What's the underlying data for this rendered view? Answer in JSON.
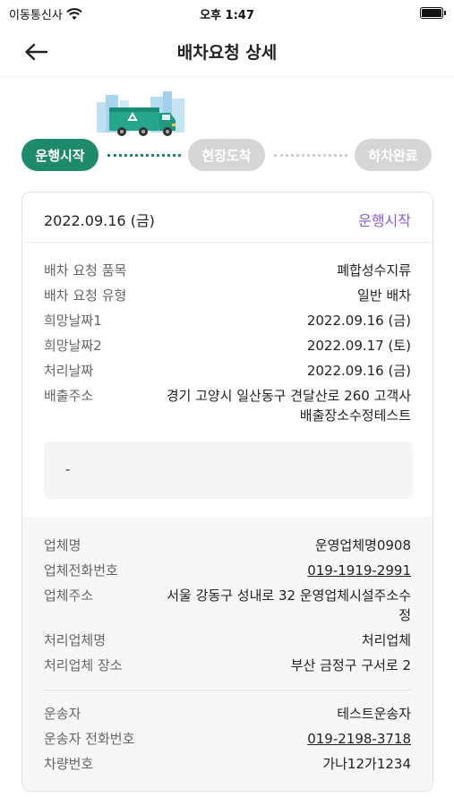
{
  "status_bar": {
    "carrier": "이동통신사",
    "time": "오후 1:47"
  },
  "header": {
    "title": "배차요청 상세"
  },
  "stepper": {
    "steps": [
      {
        "label": "운행시작",
        "active": true
      },
      {
        "label": "현장도착",
        "active": false
      },
      {
        "label": "하차완료",
        "active": false
      }
    ]
  },
  "colors": {
    "accent": "#1d8a6c",
    "status_purple": "#8a5cd6",
    "inactive_step": "#d6d6d6"
  },
  "card": {
    "date": "2022.09.16 (금)",
    "status": "운행시작",
    "request_info": [
      {
        "label": "배차 요청 품목",
        "value": "폐합성수지류"
      },
      {
        "label": "배차 요청 유형",
        "value": "일반 배차"
      },
      {
        "label": "희망날짜1",
        "value": "2022.09.16 (금)"
      },
      {
        "label": "희망날짜2",
        "value": "2022.09.17 (토)"
      },
      {
        "label": "처리날짜",
        "value": "2022.09.16 (금)"
      },
      {
        "label": "배출주소",
        "value_line1": "경기 고양시 일산동구 견달산로 260 고객사",
        "value_line2": "배출장소수정테스트"
      }
    ],
    "memo": "-",
    "company_info": [
      {
        "label": "업체명",
        "value": "운영업체명0908"
      },
      {
        "label": "업체전화번호",
        "value": "019-1919-2991"
      },
      {
        "label": "업체주소",
        "value_line1": "서울 강동구 성내로 32 운영업체시설주소수",
        "value_line2": "정"
      },
      {
        "label": "처리업체명",
        "value": "처리업체"
      },
      {
        "label": "처리업체 장소",
        "value": "부산 금정구 구서로 2"
      }
    ],
    "driver_info": [
      {
        "label": "운송자",
        "value": "테스트운송자"
      },
      {
        "label": "운송자 전화번호",
        "value": "019-2198-3718"
      },
      {
        "label": "차량번호",
        "value": "가나12가1234"
      }
    ]
  }
}
